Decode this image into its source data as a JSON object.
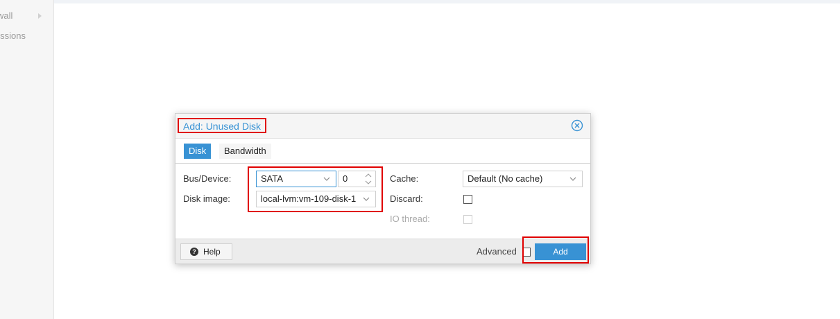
{
  "sidebar": {
    "items": [
      {
        "label": "wall"
      },
      {
        "label": "nissions"
      }
    ]
  },
  "dialog": {
    "title": "Add: Unused Disk",
    "tabs": [
      {
        "label": "Disk",
        "active": true
      },
      {
        "label": "Bandwidth",
        "active": false
      }
    ],
    "fields": {
      "bus_device_label": "Bus/Device:",
      "bus_value": "SATA",
      "device_number": "0",
      "disk_image_label": "Disk image:",
      "disk_image_value": "local-lvm:vm-109-disk-1",
      "cache_label": "Cache:",
      "cache_value": "Default (No cache)",
      "discard_label": "Discard:",
      "io_thread_label": "IO thread:"
    },
    "footer": {
      "help_label": "Help",
      "advanced_label": "Advanced",
      "add_label": "Add"
    }
  },
  "colors": {
    "accent": "#3892d4",
    "highlight": "#e00000"
  },
  "icons": {
    "close": "close-circle-icon",
    "help": "help-circle-icon",
    "dropdown": "chevron-down-icon",
    "spinner": "spinner-arrows-icon"
  }
}
